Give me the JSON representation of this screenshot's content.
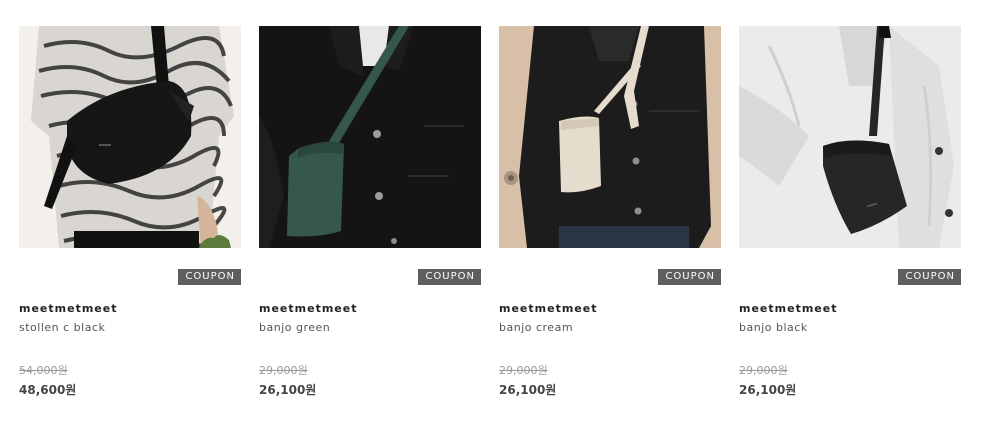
{
  "products": [
    {
      "brand": "meetmetmeet",
      "name": "stollen c black",
      "original_price": "54,000원",
      "sale_price": "48,600원",
      "coupon_label": "COUPON",
      "image_colors": {
        "bg": "#e9e4dc",
        "garment": "#2b2b2b",
        "bag": "#161616"
      }
    },
    {
      "brand": "meetmetmeet",
      "name": "banjo green",
      "original_price": "29,000원",
      "sale_price": "26,100원",
      "coupon_label": "COUPON",
      "image_colors": {
        "bg": "#dcdcd8",
        "garment": "#151515",
        "bag": "#35584a"
      }
    },
    {
      "brand": "meetmetmeet",
      "name": "banjo cream",
      "original_price": "29,000원",
      "sale_price": "26,100원",
      "coupon_label": "COUPON",
      "image_colors": {
        "bg": "#dcc4ad",
        "garment": "#1c1c1c",
        "bag": "#e6dccd"
      }
    },
    {
      "brand": "meetmetmeet",
      "name": "banjo black",
      "original_price": "29,000원",
      "sale_price": "26,100원",
      "coupon_label": "COUPON",
      "image_colors": {
        "bg": "#c9c9c9",
        "garment": "#ececec",
        "bag": "#262626"
      }
    }
  ]
}
